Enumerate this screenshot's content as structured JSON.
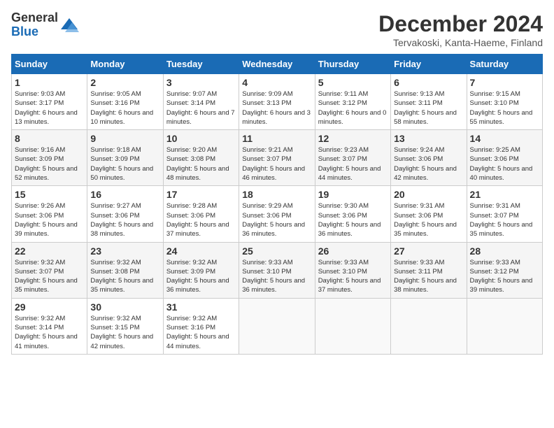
{
  "header": {
    "logo_general": "General",
    "logo_blue": "Blue",
    "title": "December 2024",
    "location": "Tervakoski, Kanta-Haeme, Finland"
  },
  "calendar": {
    "days_of_week": [
      "Sunday",
      "Monday",
      "Tuesday",
      "Wednesday",
      "Thursday",
      "Friday",
      "Saturday"
    ],
    "weeks": [
      [
        {
          "day": "1",
          "sunrise": "9:03 AM",
          "sunset": "3:17 PM",
          "daylight": "6 hours and 13 minutes."
        },
        {
          "day": "2",
          "sunrise": "9:05 AM",
          "sunset": "3:16 PM",
          "daylight": "6 hours and 10 minutes."
        },
        {
          "day": "3",
          "sunrise": "9:07 AM",
          "sunset": "3:14 PM",
          "daylight": "6 hours and 7 minutes."
        },
        {
          "day": "4",
          "sunrise": "9:09 AM",
          "sunset": "3:13 PM",
          "daylight": "6 hours and 3 minutes."
        },
        {
          "day": "5",
          "sunrise": "9:11 AM",
          "sunset": "3:12 PM",
          "daylight": "6 hours and 0 minutes."
        },
        {
          "day": "6",
          "sunrise": "9:13 AM",
          "sunset": "3:11 PM",
          "daylight": "5 hours and 58 minutes."
        },
        {
          "day": "7",
          "sunrise": "9:15 AM",
          "sunset": "3:10 PM",
          "daylight": "5 hours and 55 minutes."
        }
      ],
      [
        {
          "day": "8",
          "sunrise": "9:16 AM",
          "sunset": "3:09 PM",
          "daylight": "5 hours and 52 minutes."
        },
        {
          "day": "9",
          "sunrise": "9:18 AM",
          "sunset": "3:09 PM",
          "daylight": "5 hours and 50 minutes."
        },
        {
          "day": "10",
          "sunrise": "9:20 AM",
          "sunset": "3:08 PM",
          "daylight": "5 hours and 48 minutes."
        },
        {
          "day": "11",
          "sunrise": "9:21 AM",
          "sunset": "3:07 PM",
          "daylight": "5 hours and 46 minutes."
        },
        {
          "day": "12",
          "sunrise": "9:23 AM",
          "sunset": "3:07 PM",
          "daylight": "5 hours and 44 minutes."
        },
        {
          "day": "13",
          "sunrise": "9:24 AM",
          "sunset": "3:06 PM",
          "daylight": "5 hours and 42 minutes."
        },
        {
          "day": "14",
          "sunrise": "9:25 AM",
          "sunset": "3:06 PM",
          "daylight": "5 hours and 40 minutes."
        }
      ],
      [
        {
          "day": "15",
          "sunrise": "9:26 AM",
          "sunset": "3:06 PM",
          "daylight": "5 hours and 39 minutes."
        },
        {
          "day": "16",
          "sunrise": "9:27 AM",
          "sunset": "3:06 PM",
          "daylight": "5 hours and 38 minutes."
        },
        {
          "day": "17",
          "sunrise": "9:28 AM",
          "sunset": "3:06 PM",
          "daylight": "5 hours and 37 minutes."
        },
        {
          "day": "18",
          "sunrise": "9:29 AM",
          "sunset": "3:06 PM",
          "daylight": "5 hours and 36 minutes."
        },
        {
          "day": "19",
          "sunrise": "9:30 AM",
          "sunset": "3:06 PM",
          "daylight": "5 hours and 36 minutes."
        },
        {
          "day": "20",
          "sunrise": "9:31 AM",
          "sunset": "3:06 PM",
          "daylight": "5 hours and 35 minutes."
        },
        {
          "day": "21",
          "sunrise": "9:31 AM",
          "sunset": "3:07 PM",
          "daylight": "5 hours and 35 minutes."
        }
      ],
      [
        {
          "day": "22",
          "sunrise": "9:32 AM",
          "sunset": "3:07 PM",
          "daylight": "5 hours and 35 minutes."
        },
        {
          "day": "23",
          "sunrise": "9:32 AM",
          "sunset": "3:08 PM",
          "daylight": "5 hours and 35 minutes."
        },
        {
          "day": "24",
          "sunrise": "9:32 AM",
          "sunset": "3:09 PM",
          "daylight": "5 hours and 36 minutes."
        },
        {
          "day": "25",
          "sunrise": "9:33 AM",
          "sunset": "3:10 PM",
          "daylight": "5 hours and 36 minutes."
        },
        {
          "day": "26",
          "sunrise": "9:33 AM",
          "sunset": "3:10 PM",
          "daylight": "5 hours and 37 minutes."
        },
        {
          "day": "27",
          "sunrise": "9:33 AM",
          "sunset": "3:11 PM",
          "daylight": "5 hours and 38 minutes."
        },
        {
          "day": "28",
          "sunrise": "9:33 AM",
          "sunset": "3:12 PM",
          "daylight": "5 hours and 39 minutes."
        }
      ],
      [
        {
          "day": "29",
          "sunrise": "9:32 AM",
          "sunset": "3:14 PM",
          "daylight": "5 hours and 41 minutes."
        },
        {
          "day": "30",
          "sunrise": "9:32 AM",
          "sunset": "3:15 PM",
          "daylight": "5 hours and 42 minutes."
        },
        {
          "day": "31",
          "sunrise": "9:32 AM",
          "sunset": "3:16 PM",
          "daylight": "5 hours and 44 minutes."
        },
        null,
        null,
        null,
        null
      ]
    ]
  }
}
